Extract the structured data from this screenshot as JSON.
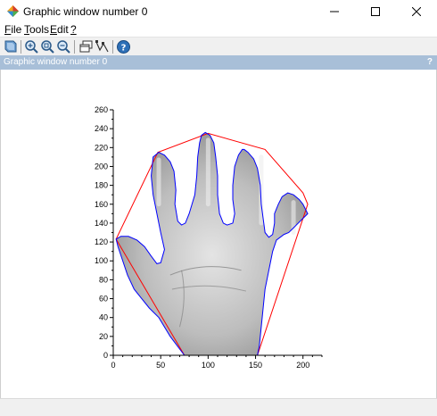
{
  "window": {
    "title": "Graphic window number 0"
  },
  "menu": [
    {
      "label": "File",
      "underline": "F",
      "rest": "ile"
    },
    {
      "label": "Tools",
      "underline": "T",
      "rest": "ools"
    },
    {
      "label": "Edit",
      "underline": "E",
      "rest": "dit"
    },
    {
      "label": "?",
      "underline": "?",
      "rest": ""
    }
  ],
  "toolbar": {
    "icons": [
      "rotate-icon",
      "zoom-in-icon",
      "zoom-fit-icon",
      "zoom-out-icon",
      "new-window-icon",
      "datatip-icon",
      "help-icon"
    ]
  },
  "dock": {
    "title": "Graphic window number 0",
    "help": "?"
  },
  "colors": {
    "hull": "#ff0000",
    "contour": "#0000ff",
    "dock_bar": "#a8bfd8"
  },
  "chart_data": {
    "type": "line",
    "title": "",
    "xlabel": "",
    "ylabel": "",
    "xlim": [
      0,
      220
    ],
    "ylim": [
      0,
      260
    ],
    "x_ticks": [
      "0",
      "50",
      "100",
      "150",
      "200"
    ],
    "y_ticks": [
      "0",
      "20",
      "40",
      "60",
      "80",
      "100",
      "120",
      "140",
      "160",
      "180",
      "200",
      "220",
      "240",
      "260"
    ],
    "grid": false,
    "series": [
      {
        "color": "#ff0000",
        "x": [
          75,
          3,
          47,
          100,
          160,
          200,
          205,
          152,
          75
        ],
        "y": [
          0,
          123,
          215,
          235,
          218,
          172,
          160,
          0,
          0
        ]
      },
      {
        "color": "#0000ff",
        "x": [
          75,
          60,
          48,
          38,
          30,
          22,
          15,
          10,
          5,
          3,
          8,
          16,
          25,
          33,
          40,
          46,
          50,
          52,
          54,
          50,
          46,
          42,
          40,
          42,
          48,
          54,
          60,
          64,
          66,
          65,
          68,
          72,
          76,
          80,
          86,
          88,
          89,
          91,
          93,
          97,
          102,
          106,
          108,
          110,
          110,
          112,
          116,
          120,
          126,
          128,
          126,
          126,
          128,
          132,
          136,
          138,
          142,
          148,
          152,
          155,
          156,
          158,
          160,
          164,
          168,
          170,
          170,
          174,
          178,
          184,
          190,
          196,
          200,
          205,
          200,
          195,
          190,
          185,
          180,
          172,
          168,
          166,
          164,
          162,
          160,
          158,
          157,
          156,
          155,
          154,
          153,
          152
        ],
        "y": [
          0,
          20,
          40,
          50,
          60,
          70,
          85,
          100,
          115,
          123,
          126,
          126,
          122,
          115,
          105,
          97,
          98,
          105,
          112,
          130,
          150,
          170,
          190,
          210,
          215,
          212,
          205,
          195,
          175,
          160,
          142,
          138,
          140,
          150,
          170,
          190,
          210,
          225,
          233,
          236,
          233,
          225,
          210,
          190,
          170,
          150,
          140,
          138,
          140,
          150,
          165,
          180,
          200,
          212,
          218,
          218,
          215,
          208,
          198,
          180,
          160,
          145,
          130,
          125,
          128,
          140,
          150,
          160,
          168,
          172,
          170,
          165,
          160,
          150,
          145,
          140,
          135,
          130,
          128,
          122,
          110,
          100,
          90,
          80,
          70,
          50,
          40,
          30,
          20,
          10,
          5,
          0
        ]
      }
    ]
  }
}
